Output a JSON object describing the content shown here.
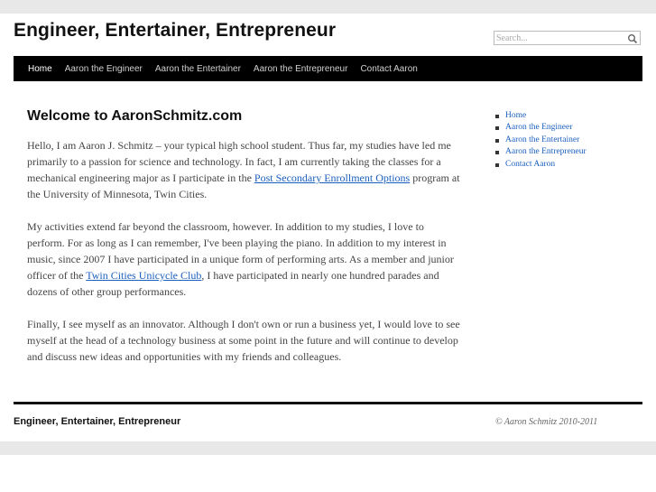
{
  "header": {
    "site_title": "Engineer, Entertainer, Entrepreneur",
    "search_placeholder": "Search..."
  },
  "nav": {
    "items": [
      {
        "label": "Home",
        "current": true
      },
      {
        "label": "Aaron the Engineer"
      },
      {
        "label": "Aaron the Entertainer"
      },
      {
        "label": "Aaron the Entrepreneur"
      },
      {
        "label": "Contact Aaron"
      }
    ]
  },
  "main": {
    "heading": "Welcome to AaronSchmitz.com",
    "p1_a": "Hello, I am Aaron J. Schmitz – your typical high school student. Thus far, my studies have led me primarily to a passion for science and technology. In fact, I am currently taking the classes for a mechanical engineering major as I participate in the ",
    "p1_link": "Post Secondary Enrollment Options",
    "p1_b": " program at the University of Minnesota, Twin Cities.",
    "p2_a": "My activities extend far beyond the classroom, however. In addition to my studies, I love to perform. For as long as I can remember, I've been playing the piano. In addition to my interest in music, since 2007 I have participated in a unique form of performing arts. As a member and junior officer of the ",
    "p2_link": "Twin Cities Unicycle Club",
    "p2_b": ", I have participated in nearly one hundred parades and dozens of other group performances.",
    "p3": "Finally, I see myself as an innovator. Although I don't own or run a business yet, I would love to see myself at the head of a technology business at some point in the future and will continue to develop and discuss new ideas and opportunities with my friends and colleagues."
  },
  "sidebar": {
    "items": [
      {
        "label": "Home"
      },
      {
        "label": "Aaron the Engineer"
      },
      {
        "label": "Aaron the Entertainer"
      },
      {
        "label": "Aaron the Entrepreneur"
      },
      {
        "label": "Contact Aaron"
      }
    ]
  },
  "footer": {
    "title": "Engineer, Entertainer, Entrepreneur",
    "copyright": "© Aaron Schmitz 2010-2011"
  },
  "icons": {
    "search": "search-icon",
    "bullet": "square-bullet"
  },
  "colors": {
    "nav_bg": "#000000",
    "link": "#1b5fbf",
    "band": "#e8e8e8"
  }
}
